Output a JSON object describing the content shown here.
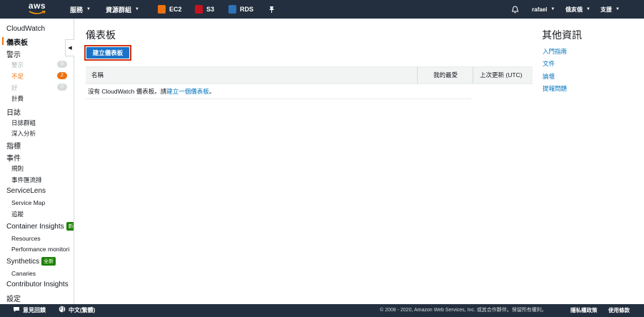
{
  "topnav": {
    "logo": "aws",
    "services": "服務",
    "resource_groups": "資源群組",
    "shortcuts": [
      {
        "label": "EC2",
        "color": "#ec7211"
      },
      {
        "label": "S3",
        "color": "#c7131f"
      },
      {
        "label": "RDS",
        "color": "#2e73b8"
      }
    ],
    "user": "rafael",
    "region": "俄亥俄",
    "support": "支援"
  },
  "sidebar": {
    "root": "CloudWatch",
    "dashboards": "儀表板",
    "alarms": "警示",
    "alarm_sub": [
      {
        "label": "警示",
        "count": "0",
        "count_color": "#d5dbdb"
      },
      {
        "label": "不足",
        "count": "2",
        "count_color": "#ec7211"
      },
      {
        "label": "好",
        "count": "0",
        "count_color": "#d5dbdb"
      },
      {
        "label": "計費"
      }
    ],
    "logs": "日誌",
    "logs_sub": [
      "日誌群組",
      "深入分析"
    ],
    "metrics": "指標",
    "events": "事件",
    "events_sub": [
      "規則",
      "事件匯流排"
    ],
    "servicelens": "ServiceLens",
    "servicelens_sub": [
      "Service Map",
      "追蹤"
    ],
    "container_insights": "Container Insights",
    "container_insights_badge": "新",
    "container_sub": [
      "Resources",
      "Performance monitori"
    ],
    "synthetics": "Synthetics",
    "synthetics_badge": "全新",
    "synthetics_sub": [
      "Canaries"
    ],
    "contributor_insights": "Contributor Insights",
    "settings": "設定"
  },
  "main": {
    "title": "儀表板",
    "create_button": "建立儀表板",
    "columns": [
      "名稱",
      "我的最愛",
      "上次更新 (UTC)"
    ],
    "empty_prefix": "沒有 CloudWatch 儀表板。請",
    "empty_link": "建立一個儀表板",
    "empty_suffix": "。"
  },
  "info_panel": {
    "title": "其他資訊",
    "links": [
      "入門指南",
      "文件",
      "論壇",
      "提報問題"
    ]
  },
  "footer": {
    "feedback": "意見回饋",
    "language": "中文(繁體)",
    "copyright": "© 2008 - 2020, Amazon Web Services, Inc. 或其合作夥伴。保留所有權利。",
    "privacy": "隱私權政策",
    "terms": "使用條款"
  }
}
